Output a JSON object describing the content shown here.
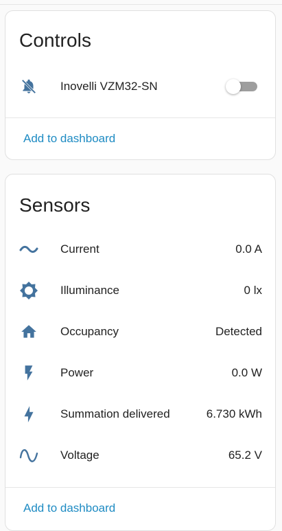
{
  "colors": {
    "icon": "#44739e",
    "link": "#1e8bc3",
    "toggle_off": "#9e9e9e"
  },
  "controls": {
    "title": "Controls",
    "items": [
      {
        "icon": "bell-off-icon",
        "label": "Inovelli VZM32-SN",
        "state": "off"
      }
    ],
    "add_link": "Add to dashboard"
  },
  "sensors": {
    "title": "Sensors",
    "items": [
      {
        "icon": "current-ac-icon",
        "label": "Current",
        "value": "0.0 A"
      },
      {
        "icon": "brightness-icon",
        "label": "Illuminance",
        "value": "0 lx"
      },
      {
        "icon": "home-icon",
        "label": "Occupancy",
        "value": "Detected"
      },
      {
        "icon": "flash-icon",
        "label": "Power",
        "value": "0.0 W"
      },
      {
        "icon": "lightning-bolt-icon",
        "label": "Summation delivered",
        "value": "6.730 kWh"
      },
      {
        "icon": "sine-wave-icon",
        "label": "Voltage",
        "value": "65.2 V"
      }
    ],
    "add_link": "Add to dashboard"
  }
}
